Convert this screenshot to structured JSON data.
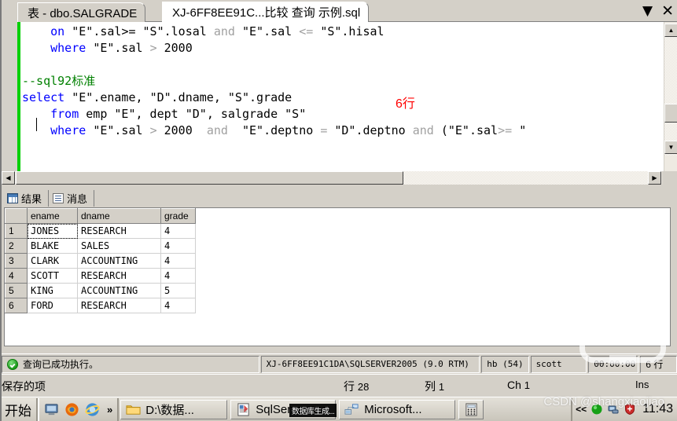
{
  "window": {
    "tabs": [
      {
        "label": "表 - dbo.SALGRADE",
        "active": false
      },
      {
        "label": "XJ-6FF8EE91C...比较 查询 示例.sql",
        "active": true
      }
    ],
    "buttons": {
      "dropdown": "▼",
      "close": "✕"
    }
  },
  "editor": {
    "lines": [
      "    on \"E\".sal>= \"S\".losal and \"E\".sal <= \"S\".hisal",
      "    where \"E\".sal > 2000",
      "",
      "--sql92标准",
      "select \"E\".ename, \"D\".dname, \"S\".grade",
      "    from emp \"E\", dept \"D\", salgrade \"S\"",
      "    where \"E\".sal > 2000  and  \"E\".deptno = \"D\".deptno and (\"E\".sal>= \""
    ],
    "annotation": "6行"
  },
  "results": {
    "tabs": [
      {
        "label": "结果",
        "icon": "grid-icon"
      },
      {
        "label": "消息",
        "icon": "message-icon"
      }
    ],
    "columns": [
      "ename",
      "dname",
      "grade"
    ],
    "rows": [
      {
        "n": "1",
        "ename": "JONES",
        "dname": "RESEARCH",
        "grade": "4"
      },
      {
        "n": "2",
        "ename": "BLAKE",
        "dname": "SALES",
        "grade": "4"
      },
      {
        "n": "3",
        "ename": "CLARK",
        "dname": "ACCOUNTING",
        "grade": "4"
      },
      {
        "n": "4",
        "ename": "SCOTT",
        "dname": "RESEARCH",
        "grade": "4"
      },
      {
        "n": "5",
        "ename": "KING",
        "dname": "ACCOUNTING",
        "grade": "5"
      },
      {
        "n": "6",
        "ename": "FORD",
        "dname": "RESEARCH",
        "grade": "4"
      }
    ]
  },
  "query_status": {
    "message": "查询已成功执行。",
    "server": "XJ-6FF8EE91C1DA\\SQLSERVER2005 (9.0 RTM)",
    "database": "hb (54)",
    "user": "scott",
    "elapsed": "00:00:00",
    "rowcount": "6 行"
  },
  "app_status": {
    "saved": "保存的项",
    "row_label": "行",
    "row_value": "28",
    "col_label": "列",
    "col_value": "1",
    "ch_label": "Ch",
    "ch_value": "1",
    "insert_mode": "Ins"
  },
  "taskbar": {
    "start": "开始",
    "quicklaunch_more": "»",
    "items": [
      {
        "label": "D:\\数据...",
        "icon": "folder-icon"
      },
      {
        "label": "SqlServer...",
        "icon": "document-icon"
      },
      {
        "label": "Microsoft...",
        "icon": "network-icon"
      },
      {
        "label": "",
        "icon": "calculator-icon"
      }
    ],
    "tooltip": "数据库生成...",
    "tray_expand": "<<",
    "clock": "11:43"
  },
  "watermark": {
    "text": "CSDN @shangxiaojiao"
  },
  "colors": {
    "chrome": "#d4d0c8",
    "keyword": "#0000ff",
    "comment": "#008000",
    "operator_gray": "#a0a0a0",
    "annotation_red": "#ff0000",
    "change_bar_green": "#00d000",
    "success_green": "#1a9a1a"
  }
}
